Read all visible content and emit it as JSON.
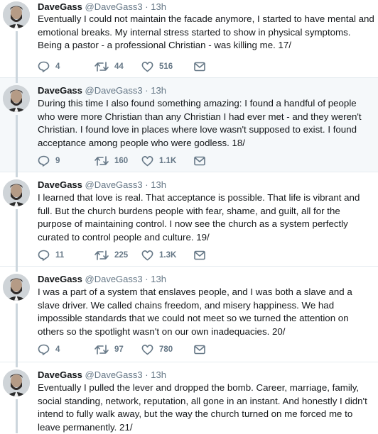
{
  "tweets": [
    {
      "name": "DaveGass",
      "handle": "@DaveGass3",
      "dot": "·",
      "time": "13h",
      "text": "Eventually I could not maintain the facade anymore, I started to have mental and emotional breaks. My internal stress started to show in physical symptoms. Being a pastor - a professional Christian - was killing me. 17/",
      "replies": "4",
      "retweets": "44",
      "likes": "516",
      "highlighted": false
    },
    {
      "name": "DaveGass",
      "handle": "@DaveGass3",
      "dot": "·",
      "time": "13h",
      "text": "During this time I also found something amazing: I found a handful of people who were more Christian than any Christian I had ever met - and they weren't Christian. I found love in places where love wasn't supposed to exist. I found acceptance among people who were godless. 18/",
      "replies": "9",
      "retweets": "160",
      "likes": "1.1K",
      "highlighted": true
    },
    {
      "name": "DaveGass",
      "handle": "@DaveGass3",
      "dot": "·",
      "time": "13h",
      "text": "I learned that love is real. That acceptance is possible. That life is vibrant and full. But the church burdens people with fear, shame, and guilt, all for the purpose of maintaining control. I now see the church as a system perfectly curated to control people and culture. 19/",
      "replies": "11",
      "retweets": "225",
      "likes": "1.3K",
      "highlighted": false
    },
    {
      "name": "DaveGass",
      "handle": "@DaveGass3",
      "dot": "·",
      "time": "13h",
      "text": "I was a part of a system that enslaves people, and I was both a slave and a slave driver. We called chains freedom, and misery happiness. We had impossible standards that we could not meet so we turned the attention on others so the spotlight wasn't on our own inadequacies. 20/",
      "replies": "4",
      "retweets": "97",
      "likes": "780",
      "highlighted": false
    },
    {
      "name": "DaveGass",
      "handle": "@DaveGass3",
      "dot": "·",
      "time": "13h",
      "text": "Eventually I pulled the lever and dropped the bomb. Career, marriage, family, social standing, network, reputation, all gone in an instant. And honestly I didn't intend to fully walk away, but the way the church turned on me forced me to leave permanently. 21/",
      "highlighted": false
    }
  ],
  "colors": {
    "text": "#14171a",
    "muted": "#657786",
    "thread_line": "#ccd6dd",
    "highlight_bg": "#f5f8fa"
  },
  "icons": [
    "avatar",
    "reply-icon",
    "retweet-icon",
    "like-icon",
    "dm-icon"
  ]
}
